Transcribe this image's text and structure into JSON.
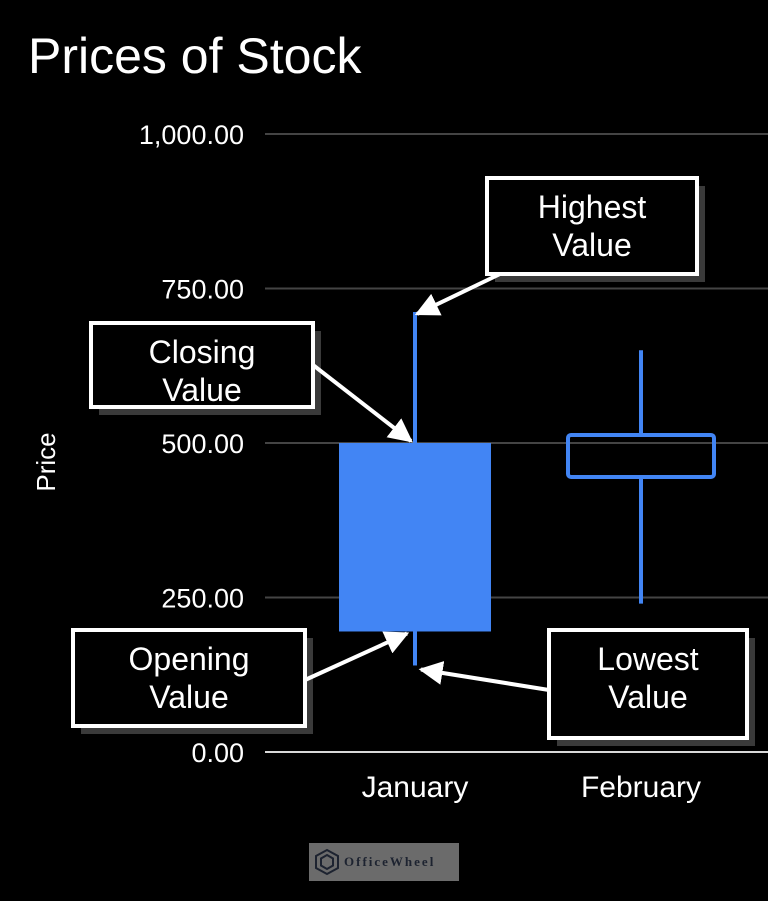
{
  "chart_data": {
    "type": "candlestick",
    "title": "Prices of Stock",
    "xlabel": "",
    "ylabel": "Price",
    "ylim": [
      0,
      1000
    ],
    "yticks": [
      0,
      250,
      500,
      750,
      1000
    ],
    "ytick_labels": [
      "0.00",
      "250.00",
      "500.00",
      "750.00",
      "1,000.00"
    ],
    "grid": true,
    "categories": [
      "January",
      "February"
    ],
    "series": [
      {
        "name": "January",
        "open": 195,
        "high": 712,
        "low": 140,
        "close": 500,
        "style": "filled"
      },
      {
        "name": "February",
        "open": 445,
        "high": 650,
        "low": 240,
        "close": 513,
        "style": "hollow"
      }
    ],
    "annotations": [
      {
        "id": "highest",
        "lines": [
          "Highest",
          "Value"
        ],
        "target": "January.high"
      },
      {
        "id": "closing",
        "lines": [
          "Closing",
          "Value"
        ],
        "target": "January.close"
      },
      {
        "id": "opening",
        "lines": [
          "Opening",
          "Value"
        ],
        "target": "January.open"
      },
      {
        "id": "lowest",
        "lines": [
          "Lowest",
          "Value"
        ],
        "target": "January.low"
      }
    ],
    "colors": {
      "candle": "#4285f4",
      "grid": "#444444",
      "axis": "#d9d9d9",
      "background": "#000000"
    }
  },
  "watermark": {
    "text": "OfficeWheel"
  }
}
